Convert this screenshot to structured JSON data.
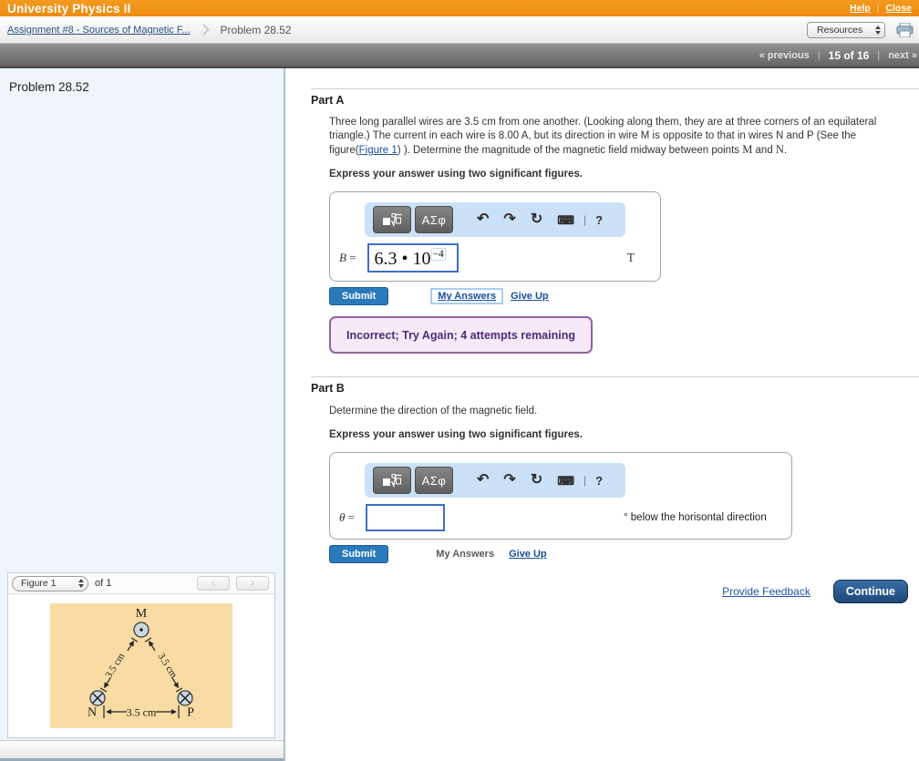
{
  "header": {
    "app_title": "University Physics II",
    "help_label": "Help",
    "close_label": "Close",
    "divider": "|"
  },
  "breadcrumb": {
    "assignment_link": "Assignment #8 - Sources of Magnetic F...",
    "current": "Problem 28.52",
    "resources_label": "Resources"
  },
  "pagenav": {
    "previous_label": "« previous",
    "position_label": "15 of 16",
    "next_label": "next »",
    "divider": "|"
  },
  "sidebar": {
    "problem_title": "Problem 28.52",
    "figure_bar": {
      "selector_value": "Figure 1",
      "of_label": "of 1",
      "prev_glyph": "‹",
      "next_glyph": "›"
    },
    "figure": {
      "background": "#f8dca4",
      "wire_top": "M",
      "wire_left": "N",
      "wire_right": "P",
      "left_side_label": "3.5 cm",
      "right_side_label": "3.5 cm",
      "bottom_label": "3.5 cm"
    }
  },
  "toolbar": {
    "greek_label": "ΑΣφ",
    "undo_glyph": "↶",
    "redo_glyph": "↷",
    "reset_glyph": "↻",
    "keyboard_glyph": "⌨",
    "divider_glyph": "|",
    "help_glyph": "?"
  },
  "part_a": {
    "title": "Part A",
    "text_1": "Three long parallel wires are 3.5 cm from one another. (Looking along them, they are at three corners of an equilateral triangle.) The current in each wire is 8.00 A, but its direction in wire M is opposite to that in wires N and P (See the figure(",
    "figure_link": "Figure 1",
    "text_2": ") ). Determine the magnitude of the magnetic field midway between points ",
    "math_m": "M",
    "text_3": " and ",
    "math_n": "N",
    "text_4": ".",
    "instruction": "Express your answer using two significant figures.",
    "answer_var": "B",
    "equals": "=",
    "answer_mantissa": "6.3 • 10",
    "answer_exponent": "−4",
    "unit": "T",
    "submit_label": "Submit",
    "my_answers_label": "My Answers",
    "give_up_label": "Give Up",
    "feedback": "Incorrect; Try Again; 4 attempts remaining"
  },
  "part_b": {
    "title": "Part B",
    "text": "Determine the direction of the magnetic field.",
    "instruction": "Express your answer using two significant figures.",
    "answer_var": "θ",
    "equals": "=",
    "answer_value": "",
    "unit_suffix": "° below the horisontal direction",
    "submit_label": "Submit",
    "my_answers_label": "My Answers",
    "give_up_label": "Give Up"
  },
  "footer": {
    "provide_feedback_label": "Provide Feedback",
    "continue_label": "Continue"
  },
  "colors": {
    "accent_orange": "#ee8a0d",
    "submit_blue": "#2a79bb",
    "link_blue": "#15509d",
    "toolbar_bg": "#cbe1f8",
    "input_border": "#3f6fc4",
    "feedback_bg": "#f6eaf9",
    "feedback_border": "#92639f",
    "feedback_text": "#4b2a78",
    "figure_bg": "#f8dca4"
  }
}
